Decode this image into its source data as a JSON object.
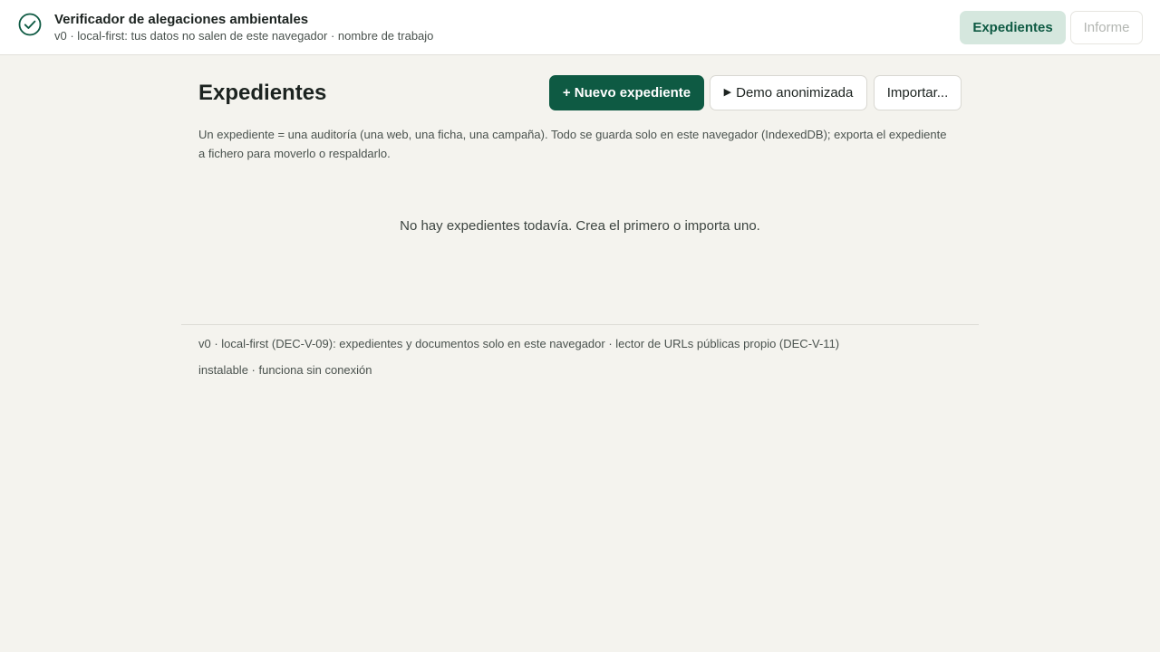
{
  "header": {
    "icon": "check-circle-icon",
    "title": "Verificador de alegaciones ambientales",
    "subtitle": "v0 · local-first: tus datos no salen de este navegador · nombre de trabajo",
    "nav": {
      "expedientes": "Expedientes",
      "informe": "Informe"
    }
  },
  "main": {
    "title": "Expedientes",
    "actions": {
      "new_case": "+ Nuevo expediente",
      "demo_icon": "play-icon",
      "demo": "Demo anonimizada",
      "import": "Importar..."
    },
    "intro": "Un expediente = una auditoría (una web, una ficha, una campaña). Todo se guarda solo en este navegador (IndexedDB); exporta el expediente a fichero para moverlo o respaldarlo.",
    "empty_state": "No hay expedientes todavía. Crea el primero o importa uno."
  },
  "footer": {
    "line1": "v0 · local-first (DEC-V-09): expedientes y documentos solo en este navegador · lector de URLs públicas propio (DEC-V-11)",
    "line2": "instalable · funciona sin conexión"
  },
  "colors": {
    "accent": "#0e5a43",
    "accent_soft": "#d5e7de",
    "background": "#f4f3ee"
  }
}
